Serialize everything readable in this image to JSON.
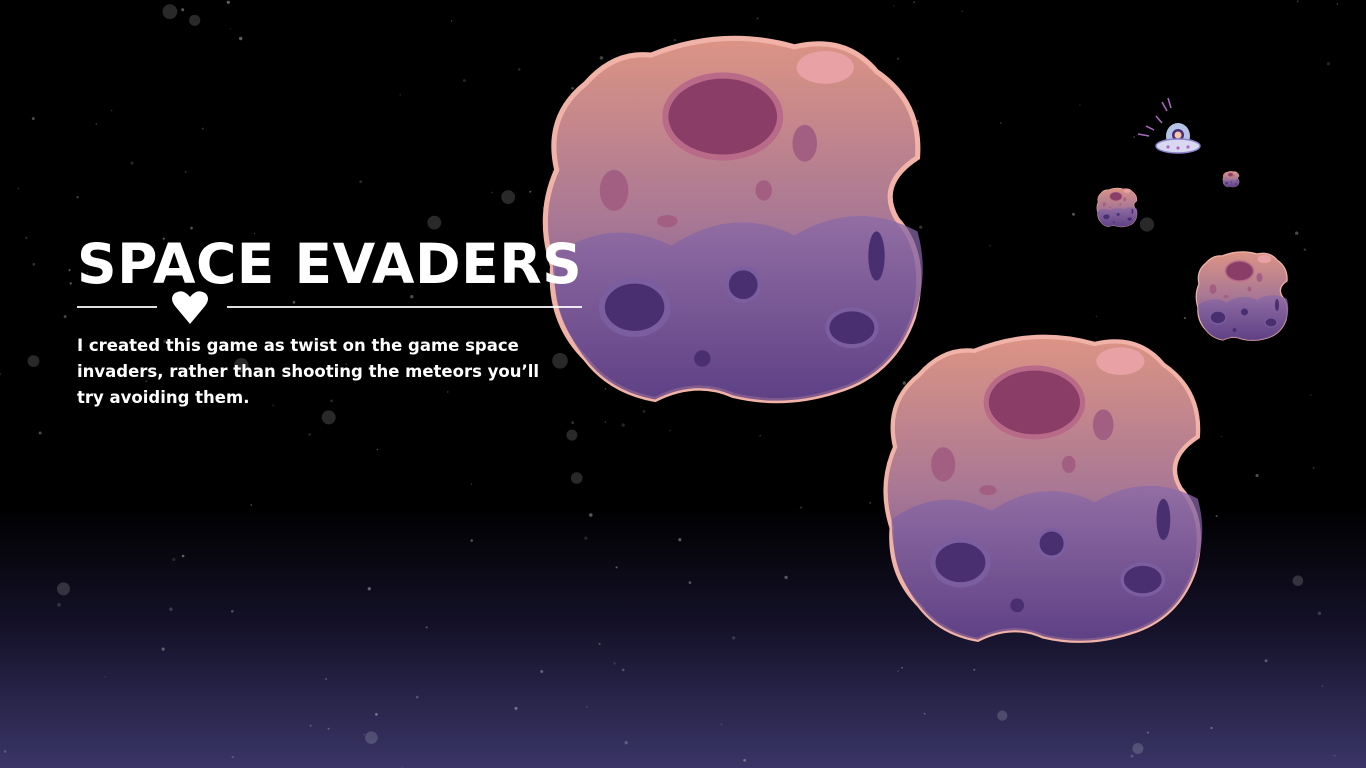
{
  "game": {
    "title": "SPACE EVADERS",
    "description": "I created this game as twist on the game space invaders, rather than shooting the meteors you’ll try avoiding them."
  },
  "divider": {
    "icon": "heart-icon"
  },
  "sprites": [
    {
      "name": "large-meteor",
      "icon": "meteor-icon"
    },
    {
      "name": "large-meteor-lower",
      "icon": "meteor-icon"
    },
    {
      "name": "small-meteor",
      "icon": "meteor-icon"
    },
    {
      "name": "tiny-meteor",
      "icon": "meteor-icon"
    },
    {
      "name": "tiny-meteor-far",
      "icon": "meteor-icon"
    },
    {
      "name": "ufo-player",
      "icon": "ufo-astronaut-icon"
    }
  ],
  "colors": {
    "meteor_top": "#dc9484",
    "meteor_bottom": "#6a4a90",
    "crater": "#8a3d66",
    "space": "#000000",
    "horizon": "#3a3566",
    "text": "#ffffff"
  }
}
